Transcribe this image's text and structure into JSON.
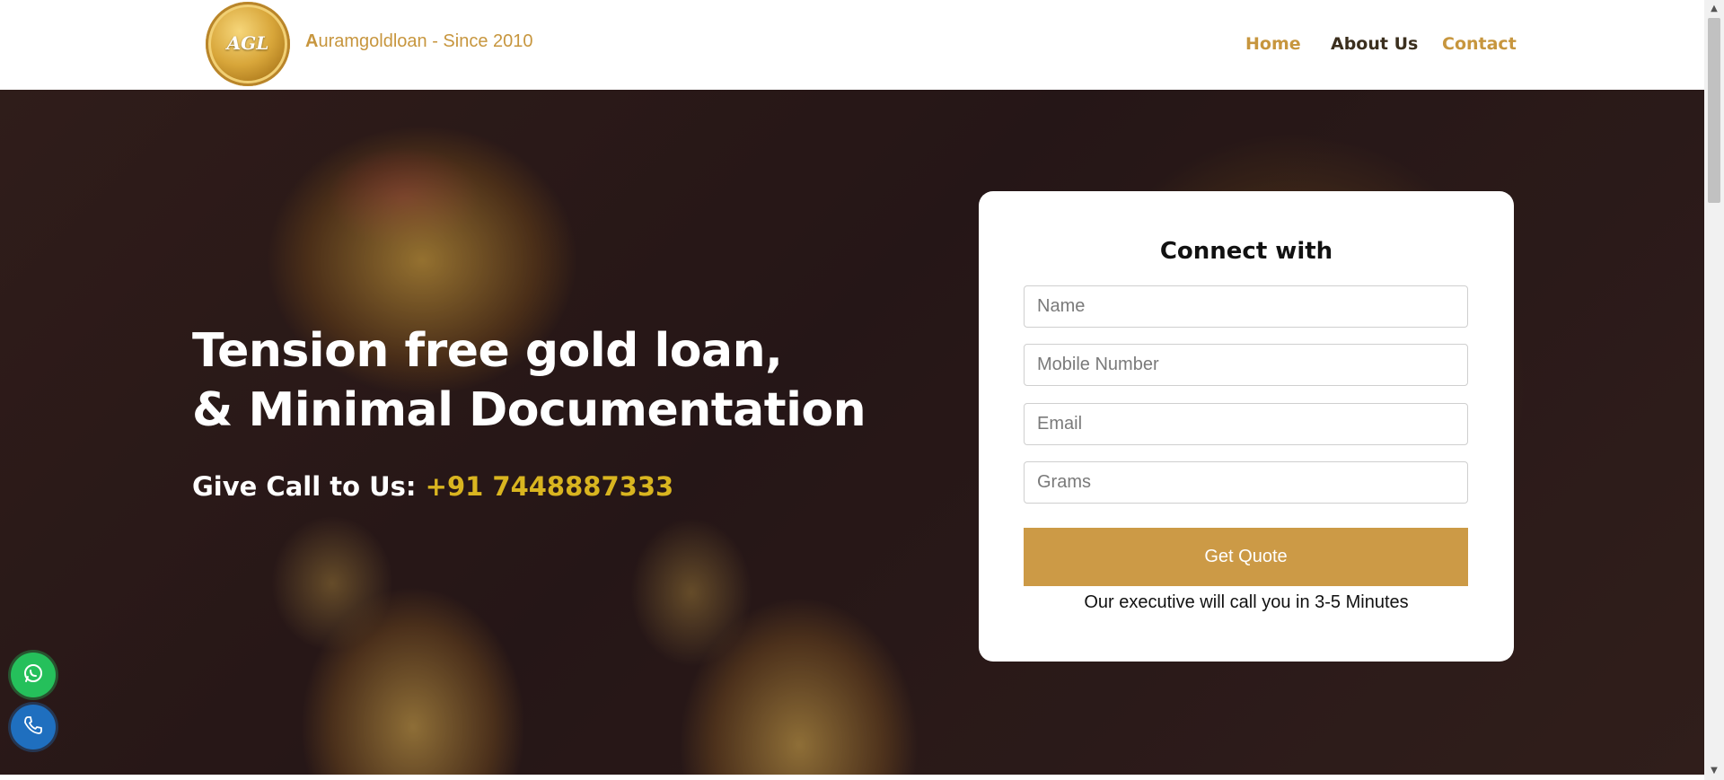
{
  "header": {
    "logo_text": "AGL",
    "brand_initial": "A",
    "brand_rest": "uramgoldloan - Since 2010",
    "nav": [
      {
        "label": "Home"
      },
      {
        "label": "About Us"
      },
      {
        "label": "Contact"
      }
    ]
  },
  "hero": {
    "headline_line1": "Tension free gold loan,",
    "headline_line2": "& Minimal Documentation",
    "call_label": "Give Call to Us: ",
    "phone": "+91 7448887333"
  },
  "form": {
    "title": "Connect with",
    "fields": [
      {
        "placeholder": "Name"
      },
      {
        "placeholder": "Mobile Number"
      },
      {
        "placeholder": "Email"
      },
      {
        "placeholder": "Grams"
      }
    ],
    "submit_label": "Get Quote",
    "note": "Our executive will call you in 3-5 Minutes"
  },
  "floating": {
    "whatsapp_icon": "whatsapp-icon",
    "phone_icon": "phone-icon"
  },
  "colors": {
    "gold": "#c7963e",
    "button": "#cc9a46",
    "phone_highlight": "#d9b520",
    "whatsapp": "#25c05b",
    "call": "#1f6fbf"
  }
}
